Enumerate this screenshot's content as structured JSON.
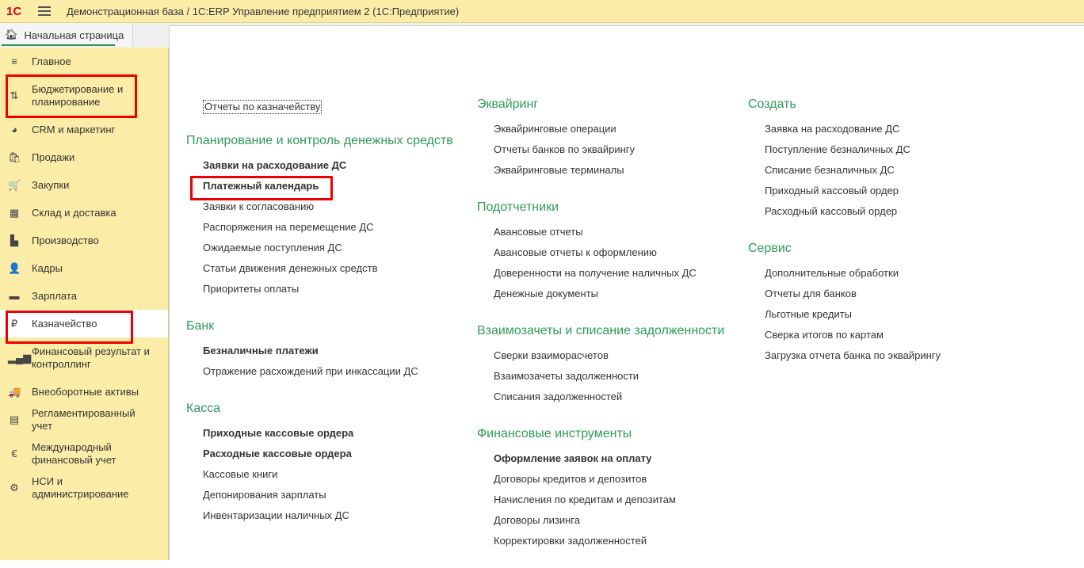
{
  "app": {
    "logo": "1С",
    "title": "Демонстрационная база / 1С:ERP Управление предприятием 2  (1С:Предприятие)"
  },
  "tab": {
    "label": "Начальная страница"
  },
  "sidebar": [
    {
      "label": "Главное",
      "icon": "≡"
    },
    {
      "label": "Бюджетирование и планирование",
      "icon": "⇅"
    },
    {
      "label": "CRM и маркетинг",
      "icon": "◕"
    },
    {
      "label": "Продажи",
      "icon": "🛍"
    },
    {
      "label": "Закупки",
      "icon": "🛒"
    },
    {
      "label": "Склад и доставка",
      "icon": "▦"
    },
    {
      "label": "Производство",
      "icon": "▙"
    },
    {
      "label": "Кадры",
      "icon": "👤"
    },
    {
      "label": "Зарплата",
      "icon": "▬"
    },
    {
      "label": "Казначейство",
      "icon": "₽"
    },
    {
      "label": "Финансовый результат и контроллинг",
      "icon": "▂▄▆"
    },
    {
      "label": "Внеоборотные активы",
      "icon": "🚚"
    },
    {
      "label": "Регламентированный учет",
      "icon": "▤"
    },
    {
      "label": "Международный финансовый учет",
      "icon": "€"
    },
    {
      "label": "НСИ и администрирование",
      "icon": "⚙"
    }
  ],
  "main": {
    "reports_link": "Отчеты по казначейству",
    "col1": [
      {
        "title": "Планирование и контроль денежных средств",
        "items": [
          {
            "t": "Заявки на расходование ДС",
            "b": true
          },
          {
            "t": "Платежный календарь",
            "b": true
          },
          {
            "t": "Заявки к согласованию"
          },
          {
            "t": "Распоряжения на перемещение ДС"
          },
          {
            "t": "Ожидаемые поступления ДС"
          },
          {
            "t": "Статьи движения денежных средств"
          },
          {
            "t": "Приоритеты оплаты"
          }
        ]
      },
      {
        "title": "Банк",
        "items": [
          {
            "t": "Безналичные платежи",
            "b": true
          },
          {
            "t": "Отражение расхождений при инкассации ДС"
          }
        ]
      },
      {
        "title": "Касса",
        "items": [
          {
            "t": "Приходные кассовые ордера",
            "b": true
          },
          {
            "t": "Расходные кассовые ордера",
            "b": true
          },
          {
            "t": "Кассовые книги"
          },
          {
            "t": "Депонирования зарплаты"
          },
          {
            "t": "Инвентаризации наличных ДС"
          }
        ]
      }
    ],
    "col2": [
      {
        "title": "Эквайринг",
        "items": [
          {
            "t": "Эквайринговые операции"
          },
          {
            "t": "Отчеты банков по эквайрингу"
          },
          {
            "t": "Эквайринговые терминалы"
          }
        ]
      },
      {
        "title": "Подотчетники",
        "items": [
          {
            "t": "Авансовые отчеты"
          },
          {
            "t": "Авансовые отчеты к оформлению"
          },
          {
            "t": "Доверенности на получение наличных ДС"
          },
          {
            "t": "Денежные документы"
          }
        ]
      },
      {
        "title": "Взаимозачеты и списание задолженности",
        "items": [
          {
            "t": "Сверки взаиморасчетов"
          },
          {
            "t": "Взаимозачеты задолженности"
          },
          {
            "t": "Списания задолженностей"
          }
        ]
      },
      {
        "title": "Финансовые инструменты",
        "items": [
          {
            "t": "Оформление заявок на оплату",
            "b": true
          },
          {
            "t": "Договоры кредитов и депозитов"
          },
          {
            "t": "Начисления по кредитам и депозитам"
          },
          {
            "t": "Договоры лизинга"
          },
          {
            "t": "Корректировки задолженностей"
          }
        ]
      }
    ],
    "col3": [
      {
        "title": "Создать",
        "items": [
          {
            "t": "Заявка на расходование ДС"
          },
          {
            "t": "Поступление безналичных ДС"
          },
          {
            "t": "Списание безналичных ДС"
          },
          {
            "t": "Приходный кассовый ордер"
          },
          {
            "t": "Расходный кассовый ордер"
          }
        ]
      },
      {
        "title": "Сервис",
        "items": [
          {
            "t": "Дополнительные обработки"
          },
          {
            "t": "Отчеты для банков"
          },
          {
            "t": "Льготные кредиты"
          },
          {
            "t": "Сверка итогов по картам"
          },
          {
            "t": "Загрузка отчета банка по эквайрингу"
          }
        ]
      }
    ]
  },
  "colors": {
    "accent": "#2e9a5a",
    "sidebar": "#fbeda8",
    "highlight": "#e00000"
  }
}
